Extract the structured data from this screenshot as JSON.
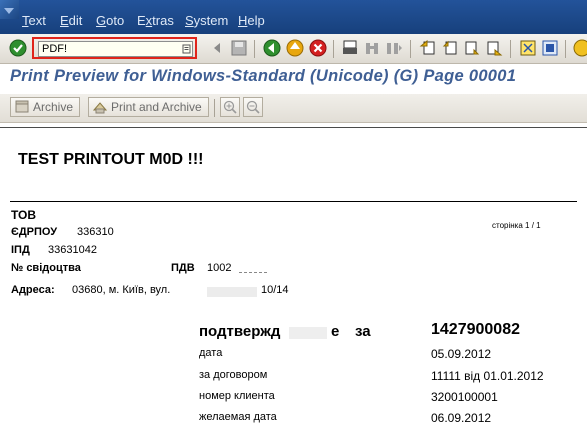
{
  "menu": [
    "Text",
    "Edit",
    "Goto",
    "Extras",
    "System",
    "Help"
  ],
  "menu_mnemonics": [
    "T",
    "E",
    "G",
    "x",
    "S",
    "H"
  ],
  "command_field": {
    "value": "PDF!"
  },
  "title": "Print Preview for Windows-Standard (Unicode) (G) Page 00001",
  "app_toolbar": {
    "archive": "Archive",
    "print_and_archive": "Print and Archive"
  },
  "document": {
    "heading": "TEST  PRINTOUT  M0D  !!!",
    "company": "ТОВ",
    "edrpou_label": "ЄДРПОУ",
    "edrpou_value": "336310",
    "ipn_label": "ІПД",
    "ipn_value": "33631042",
    "cert_label": "№  свідоцтва",
    "pdv_label": "ПДВ",
    "pdv_value": "1002",
    "page_label": "сторінка  1  /  1",
    "address_label": "Адреса:",
    "address_value": "03680,  м.  Київ,  вул.",
    "address_value2": "10/14",
    "confirm_title": "подтвержд",
    "confirm_title2": "е",
    "confirm_title3": "за",
    "doc_number": "1427900082",
    "rows": [
      {
        "label": "дата",
        "value": "05.09.2012"
      },
      {
        "label": "за  договором",
        "value": "11111  від  01.01.2012"
      },
      {
        "label": "номер  клиента",
        "value": "3200100001"
      },
      {
        "label": "желаемая  дата",
        "value": "06.09.2012"
      }
    ]
  }
}
